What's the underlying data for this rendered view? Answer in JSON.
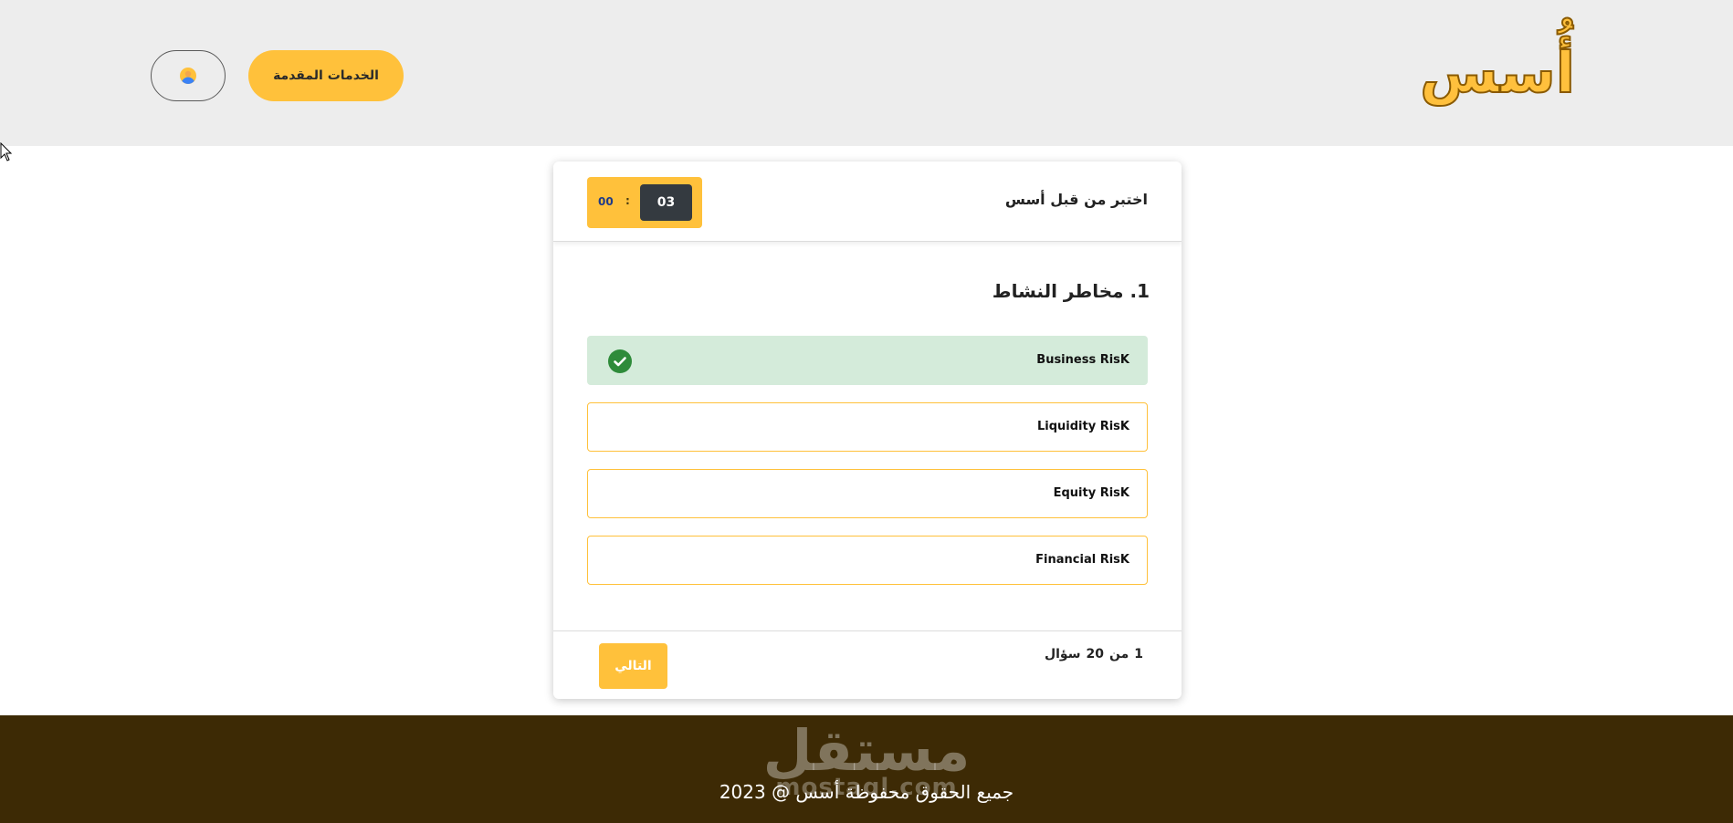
{
  "header": {
    "logo_text": "أُسس",
    "services_label": "الخدمات المقدمة",
    "user_icon": "user-avatar-icon"
  },
  "quiz": {
    "title": "اختبر من قبل أسس",
    "timer": {
      "minutes": "03",
      "separator": ":",
      "seconds": "00"
    },
    "question": "1. مخاطر النشاط",
    "options": [
      {
        "label": "Business RisK",
        "state": "correct"
      },
      {
        "label": "Liquidity RisK",
        "state": "default"
      },
      {
        "label": "Equity RisK",
        "state": "default"
      },
      {
        "label": "Financial RisK",
        "state": "default"
      }
    ],
    "progress": {
      "current": "1",
      "of_label": "من",
      "total": "20",
      "unit": "سؤال"
    },
    "next_label": "التالي"
  },
  "footer": {
    "watermark": "مستقل",
    "watermark_sub": "mostaql.com",
    "copyright": "جميع الحقوق محفوظة أسس @ 2023"
  },
  "colors": {
    "accent": "#ffc13b",
    "header_bg": "#ededed",
    "footer_bg": "#3d2a05",
    "correct_bg": "#d4ebda",
    "correct_icon": "#2e8b3a",
    "timer_dark": "#343a40"
  }
}
